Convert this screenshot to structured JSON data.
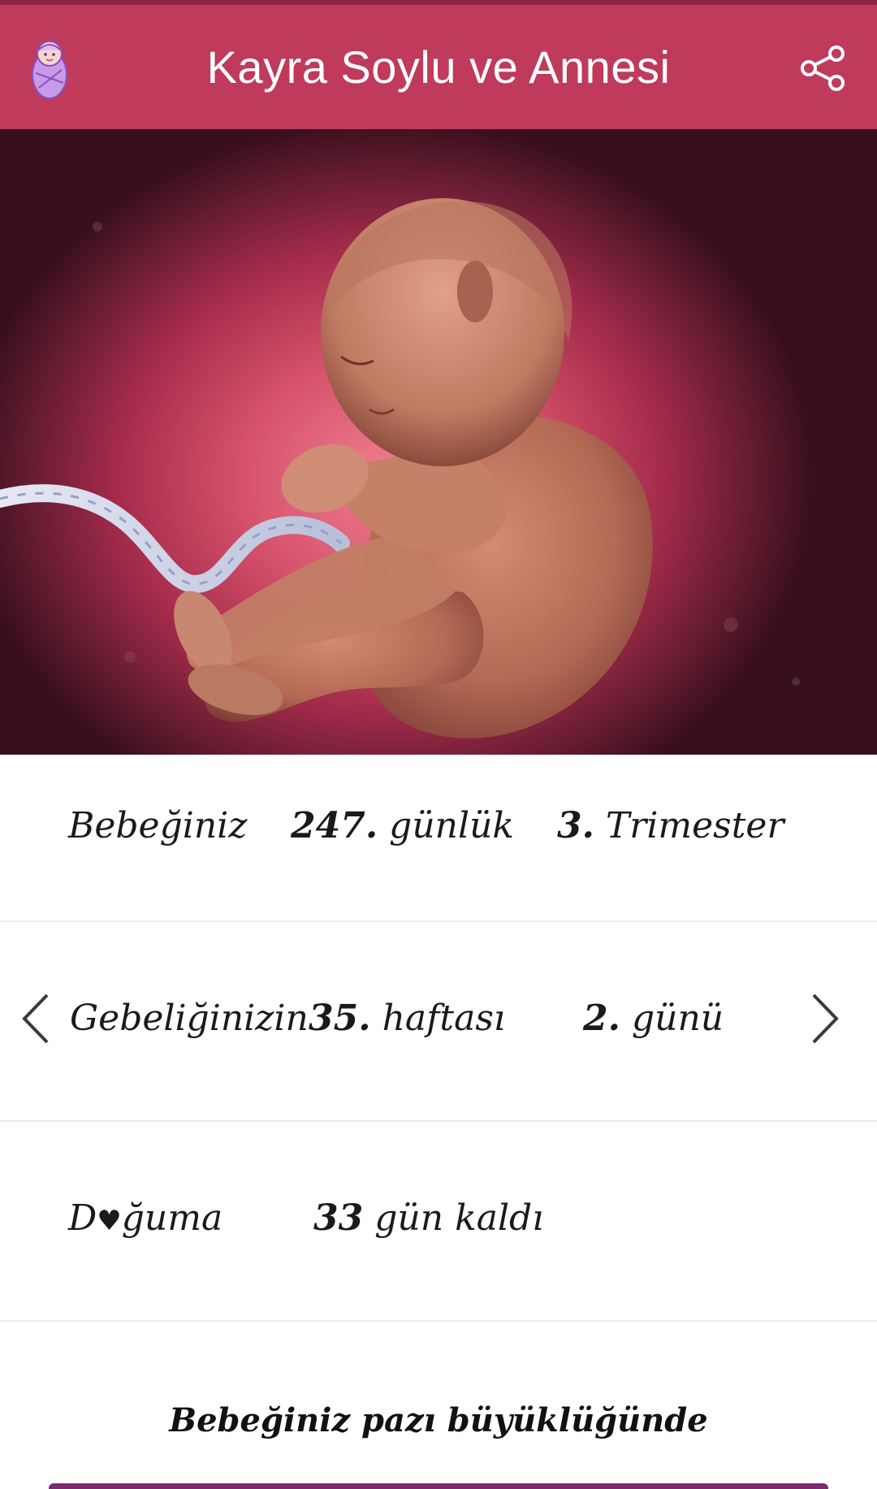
{
  "app_bar": {
    "title": "Kayra Soylu ve Annesi",
    "app_icon": "swaddled-baby-icon",
    "share_icon": "share-icon",
    "background_color": "#bf3a5b"
  },
  "hero": {
    "image": "fetus-illustration"
  },
  "stats": {
    "row1": {
      "label": "Bebeğiniz",
      "days_number": "247.",
      "days_unit": "günlük",
      "trimester_number": "3.",
      "trimester_unit": "Trimester"
    },
    "row2": {
      "label": "Gebeliğinizin",
      "week_number": "35.",
      "week_unit": "haftası",
      "day_number": "2.",
      "day_unit": "günü",
      "prev_icon": "chevron-left-icon",
      "next_icon": "chevron-right-icon"
    },
    "row3": {
      "label_part1": "D",
      "label_heart": "♥",
      "label_part2": "ğuma",
      "remaining_number": "33",
      "remaining_unit": "gün kaldı"
    }
  },
  "size_caption": "Bebeğiniz pazı büyüklüğünde"
}
